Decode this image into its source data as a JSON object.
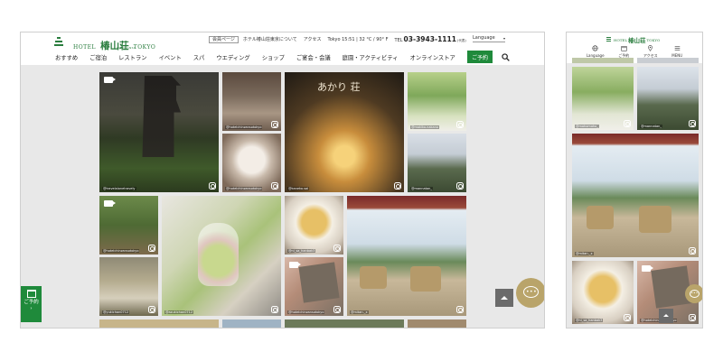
{
  "desktop": {
    "logo": {
      "hotel": "HOTEL",
      "name": "椿山荘",
      "tokyo": "TOKYO",
      "sub": "CHINZANSO"
    },
    "utility": {
      "member": "会員ページ",
      "about": "ホテル椿山荘東京について",
      "access": "アクセス",
      "status": "Tokyo 15:51 | 32 °C / 90° F",
      "tel_prefix": "TEL",
      "tel_number": "03-3943-1111",
      "tel_suffix": "(代表)"
    },
    "language": "Language",
    "nav": [
      "おすすめ",
      "ご宿泊",
      "レストラン",
      "イベント",
      "スパ",
      "ウエディング",
      "ショップ",
      "ご宴会・会議",
      "庭園・アクティビティ",
      "オンラインストア"
    ],
    "reserve_label": "ご予約",
    "fab_reserve_label": "ご予約",
    "tiles": [
      {
        "caption": "@travelalonetravely",
        "overlay": ""
      },
      {
        "caption": "@hotelchinzansotokyo",
        "overlay": ""
      },
      {
        "caption": "@hotelchinzansotokyo",
        "overlay": ""
      },
      {
        "caption": "@kaneko.sai",
        "overlay": "あかり 荘"
      },
      {
        "caption": "@makiko.nakano",
        "overlay": ""
      },
      {
        "caption": "@mannatan_",
        "overlay": ""
      },
      {
        "caption": "@hotelchinzansotokyo",
        "overlay": ""
      },
      {
        "caption": "@azukichan0712",
        "overlay": ""
      },
      {
        "caption": "@ni_sa_hanbak3",
        "overlay": ""
      },
      {
        "caption": "@yukichan0712",
        "overlay": ""
      },
      {
        "caption": "@hotelchinzansotokyo",
        "overlay": ""
      },
      {
        "caption": "@mitan._x",
        "overlay": ""
      }
    ]
  },
  "mobile": {
    "logo": {
      "hotel": "HOTEL",
      "name": "椿山荘",
      "tokyo": "TOKYO"
    },
    "icons": [
      {
        "label": "Language",
        "icon": "globe-icon"
      },
      {
        "label": "ご予約",
        "icon": "calendar-icon"
      },
      {
        "label": "アクセス",
        "icon": "map-pin-icon"
      },
      {
        "label": "MENU",
        "icon": "menu-icon"
      }
    ],
    "tiles": [
      {
        "caption": "@mahomaho_"
      },
      {
        "caption": "@mannatan_"
      },
      {
        "caption": "@mitan._x"
      },
      {
        "caption": "@ni_sa_hanbak3"
      },
      {
        "caption": "@hotelchinzansotokyo"
      }
    ]
  },
  "colors": {
    "brand_green": "#1f8a3b",
    "logo_green": "#2a7d3e",
    "chat_gold": "#b9a46a",
    "scroll_grey": "#6b6b6b"
  }
}
